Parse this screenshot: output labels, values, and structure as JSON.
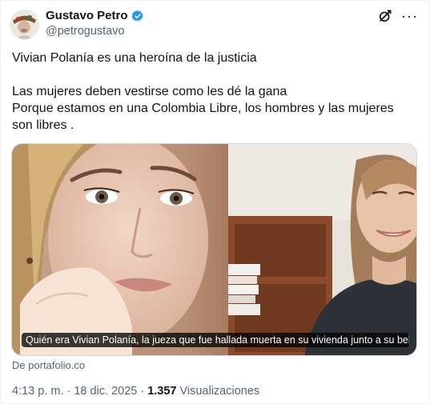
{
  "author": {
    "name": "Gustavo Petro",
    "handle": "@petrogustavo"
  },
  "tweet": {
    "lines": [
      "Vivian Polanía es una heroína de la justicia",
      "Las mujeres deben vestirse como les dé la gana",
      "Porque estamos en una Colombia Libre, los hombres y las mujeres son libres ."
    ]
  },
  "card": {
    "caption": "Quién era Vivian Polanía, la jueza que fue hallada muerta en su vivienda junto a su beb...",
    "source": "De portafolio.co"
  },
  "meta": {
    "time": "4:13 p. m.",
    "separator1": "·",
    "date": "18 dic. 2025",
    "separator2": "·",
    "views_count": "1.357",
    "views_label": "Visualizaciones"
  },
  "icons": {
    "verified": "verified-badge-icon",
    "grok": "grok-icon",
    "more": "more-icon"
  },
  "colors": {
    "verified": "#1d9bf0",
    "secondary_text": "#536471",
    "primary_text": "#0f1419"
  }
}
